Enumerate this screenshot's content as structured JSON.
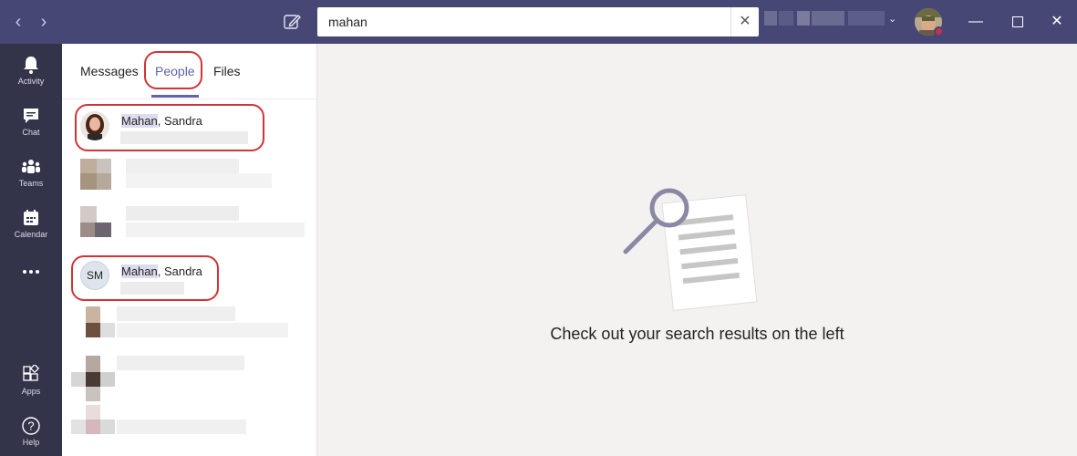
{
  "search": {
    "value": "mahan"
  },
  "rail": [
    {
      "label": "Activity"
    },
    {
      "label": "Chat"
    },
    {
      "label": "Teams"
    },
    {
      "label": "Calendar"
    },
    {
      "label": "Apps"
    },
    {
      "label": "Help"
    }
  ],
  "tabs": {
    "messages": "Messages",
    "people": "People",
    "files": "Files"
  },
  "results": [
    {
      "highlight": "Mahan",
      "rest": ", Sandra"
    },
    {
      "initials": "SM",
      "highlight": "Mahan",
      "rest": ", Sandra"
    }
  ],
  "empty_state": {
    "message": "Check out your search results on the left"
  },
  "colors": {
    "brand": "#6264a7",
    "titlebar": "#464775",
    "rail": "#33344a",
    "annotation": "#d13438",
    "busy": "#c4314b"
  },
  "icons": [
    "back-arrow-icon",
    "forward-arrow-icon",
    "compose-icon",
    "clear-icon",
    "chevron-down-icon",
    "bell-icon",
    "chat-icon",
    "teams-icon",
    "calendar-icon",
    "more-icon",
    "apps-icon",
    "help-icon",
    "minimize-icon",
    "maximize-icon",
    "close-icon",
    "magnifier-document-icon"
  ]
}
